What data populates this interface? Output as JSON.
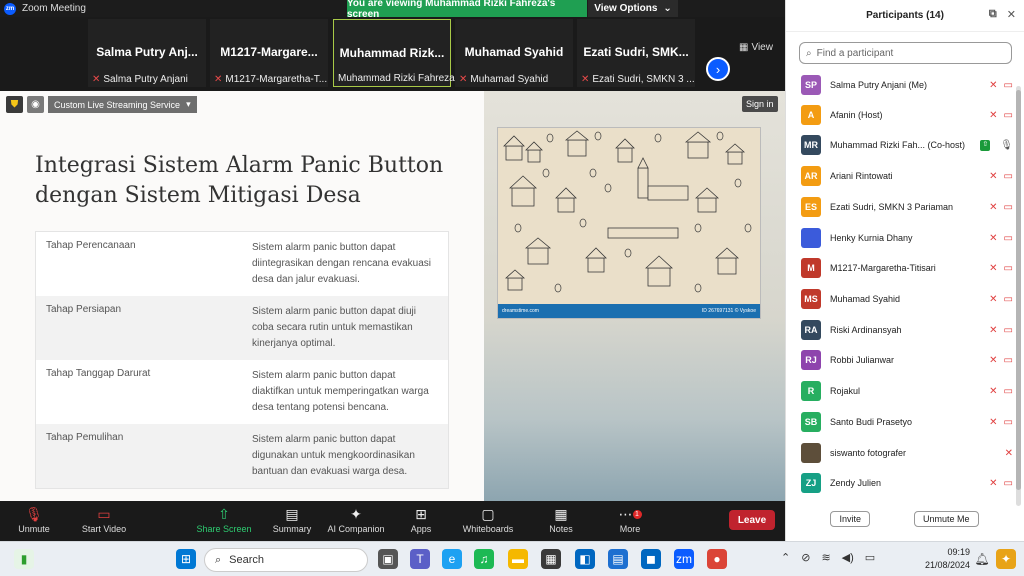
{
  "window": {
    "title": "Zoom Meeting",
    "share_banner": "You are viewing Muhammad Rizki Fahreza's screen",
    "view_options": "View Options"
  },
  "video_tiles": [
    {
      "big": "Salma Putry Anj...",
      "small": "Salma Putry Anjani"
    },
    {
      "big": "M1217-Margare...",
      "small": "M1217-Margaretha-T..."
    },
    {
      "big": "Muhammad Rizk...",
      "small": "Muhammad Rizki Fahreza"
    },
    {
      "big": "Muhamad Syahid",
      "small": "Muhamad Syahid"
    },
    {
      "big": "Ezati Sudri, SMK...",
      "small": "Ezati Sudri, SMKN 3 ..."
    }
  ],
  "view_label": "View",
  "browser": {
    "dropdown": "Custom Live Streaming Service",
    "signin": "Sign in"
  },
  "doc": {
    "title": "Integrasi Sistem Alarm Panic Button dengan Sistem Mitigasi Desa",
    "rows": [
      {
        "stage": "Tahap Perencanaan",
        "desc": "Sistem alarm panic button dapat diintegrasikan dengan rencana evakuasi desa dan jalur evakuasi."
      },
      {
        "stage": "Tahap Persiapan",
        "desc": "Sistem alarm panic button dapat diuji coba secara rutin untuk memastikan kinerjanya optimal."
      },
      {
        "stage": "Tahap Tanggap Darurat",
        "desc": "Sistem alarm panic button dapat diaktifkan untuk memperingatkan warga desa tentang potensi bencana."
      },
      {
        "stage": "Tahap Pemulihan",
        "desc": "Sistem alarm panic button dapat digunakan untuk mengkoordinasikan bantuan dan evakuasi warga desa."
      }
    ],
    "map_left": "dreamstime.com",
    "map_right": "ID 267697131 © Vyskoe"
  },
  "toolbar": {
    "unmute": "Unmute",
    "start_video": "Start Video",
    "share_screen": "Share Screen",
    "summary": "Summary",
    "ai_companion": "AI Companion",
    "apps": "Apps",
    "whiteboards": "Whiteboards",
    "notes": "Notes",
    "more": "More",
    "more_badge": "1",
    "leave": "Leave"
  },
  "panel": {
    "title": "Participants (14)",
    "search_placeholder": "Find a participant",
    "invite": "Invite",
    "unmute_me": "Unmute Me",
    "participants": [
      {
        "initials": "SP",
        "name": "Salma Putry Anjani (Me)",
        "color": "#9b59b6"
      },
      {
        "initials": "A",
        "name": "Afanin (Host)",
        "color": "#f39c12"
      },
      {
        "initials": "MR",
        "name": "Muhammad Rizki Fah... (Co-host)",
        "color": "#34495e"
      },
      {
        "initials": "AR",
        "name": "Ariani Rintowati",
        "color": "#f39c12"
      },
      {
        "initials": "ES",
        "name": "Ezati Sudri, SMKN 3 Pariaman",
        "color": "#f39c12"
      },
      {
        "initials": "",
        "name": "Henky Kurnia Dhany",
        "color": "#3b5bdb"
      },
      {
        "initials": "M",
        "name": "M1217-Margaretha-Titisari",
        "color": "#c0392b"
      },
      {
        "initials": "MS",
        "name": "Muhamad Syahid",
        "color": "#c0392b"
      },
      {
        "initials": "RA",
        "name": "Riski Ardinansyah",
        "color": "#34495e"
      },
      {
        "initials": "RJ",
        "name": "Robbi Julianwar",
        "color": "#8e44ad"
      },
      {
        "initials": "R",
        "name": "Rojakul",
        "color": "#27ae60"
      },
      {
        "initials": "SB",
        "name": "Santo Budi Prasetyo",
        "color": "#27ae60"
      },
      {
        "initials": "",
        "name": "siswanto fotografer",
        "color": "#5d4e3a"
      },
      {
        "initials": "ZJ",
        "name": "Zendy Julien",
        "color": "#16a085"
      }
    ]
  },
  "taskbar": {
    "search": "Search",
    "time": "09:19",
    "date": "21/08/2024",
    "notif_badge": "1"
  }
}
